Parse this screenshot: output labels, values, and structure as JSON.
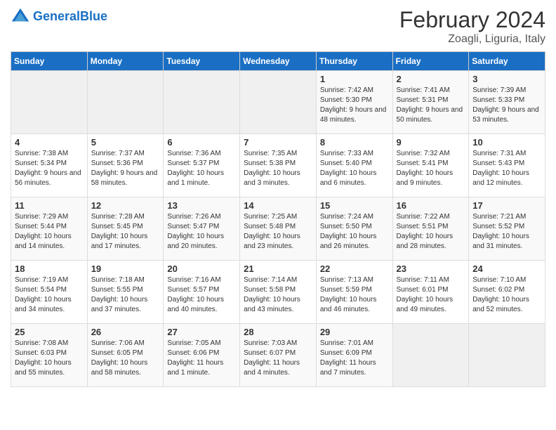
{
  "app": {
    "logo_general": "General",
    "logo_blue": "Blue",
    "title": "February 2024",
    "subtitle": "Zoagli, Liguria, Italy"
  },
  "calendar": {
    "days_of_week": [
      "Sunday",
      "Monday",
      "Tuesday",
      "Wednesday",
      "Thursday",
      "Friday",
      "Saturday"
    ],
    "weeks": [
      [
        {
          "day": "",
          "info": ""
        },
        {
          "day": "",
          "info": ""
        },
        {
          "day": "",
          "info": ""
        },
        {
          "day": "",
          "info": ""
        },
        {
          "day": "1",
          "info": "Sunrise: 7:42 AM\nSunset: 5:30 PM\nDaylight: 9 hours and 48 minutes."
        },
        {
          "day": "2",
          "info": "Sunrise: 7:41 AM\nSunset: 5:31 PM\nDaylight: 9 hours and 50 minutes."
        },
        {
          "day": "3",
          "info": "Sunrise: 7:39 AM\nSunset: 5:33 PM\nDaylight: 9 hours and 53 minutes."
        }
      ],
      [
        {
          "day": "4",
          "info": "Sunrise: 7:38 AM\nSunset: 5:34 PM\nDaylight: 9 hours and 56 minutes."
        },
        {
          "day": "5",
          "info": "Sunrise: 7:37 AM\nSunset: 5:36 PM\nDaylight: 9 hours and 58 minutes."
        },
        {
          "day": "6",
          "info": "Sunrise: 7:36 AM\nSunset: 5:37 PM\nDaylight: 10 hours and 1 minute."
        },
        {
          "day": "7",
          "info": "Sunrise: 7:35 AM\nSunset: 5:38 PM\nDaylight: 10 hours and 3 minutes."
        },
        {
          "day": "8",
          "info": "Sunrise: 7:33 AM\nSunset: 5:40 PM\nDaylight: 10 hours and 6 minutes."
        },
        {
          "day": "9",
          "info": "Sunrise: 7:32 AM\nSunset: 5:41 PM\nDaylight: 10 hours and 9 minutes."
        },
        {
          "day": "10",
          "info": "Sunrise: 7:31 AM\nSunset: 5:43 PM\nDaylight: 10 hours and 12 minutes."
        }
      ],
      [
        {
          "day": "11",
          "info": "Sunrise: 7:29 AM\nSunset: 5:44 PM\nDaylight: 10 hours and 14 minutes."
        },
        {
          "day": "12",
          "info": "Sunrise: 7:28 AM\nSunset: 5:45 PM\nDaylight: 10 hours and 17 minutes."
        },
        {
          "day": "13",
          "info": "Sunrise: 7:26 AM\nSunset: 5:47 PM\nDaylight: 10 hours and 20 minutes."
        },
        {
          "day": "14",
          "info": "Sunrise: 7:25 AM\nSunset: 5:48 PM\nDaylight: 10 hours and 23 minutes."
        },
        {
          "day": "15",
          "info": "Sunrise: 7:24 AM\nSunset: 5:50 PM\nDaylight: 10 hours and 26 minutes."
        },
        {
          "day": "16",
          "info": "Sunrise: 7:22 AM\nSunset: 5:51 PM\nDaylight: 10 hours and 28 minutes."
        },
        {
          "day": "17",
          "info": "Sunrise: 7:21 AM\nSunset: 5:52 PM\nDaylight: 10 hours and 31 minutes."
        }
      ],
      [
        {
          "day": "18",
          "info": "Sunrise: 7:19 AM\nSunset: 5:54 PM\nDaylight: 10 hours and 34 minutes."
        },
        {
          "day": "19",
          "info": "Sunrise: 7:18 AM\nSunset: 5:55 PM\nDaylight: 10 hours and 37 minutes."
        },
        {
          "day": "20",
          "info": "Sunrise: 7:16 AM\nSunset: 5:57 PM\nDaylight: 10 hours and 40 minutes."
        },
        {
          "day": "21",
          "info": "Sunrise: 7:14 AM\nSunset: 5:58 PM\nDaylight: 10 hours and 43 minutes."
        },
        {
          "day": "22",
          "info": "Sunrise: 7:13 AM\nSunset: 5:59 PM\nDaylight: 10 hours and 46 minutes."
        },
        {
          "day": "23",
          "info": "Sunrise: 7:11 AM\nSunset: 6:01 PM\nDaylight: 10 hours and 49 minutes."
        },
        {
          "day": "24",
          "info": "Sunrise: 7:10 AM\nSunset: 6:02 PM\nDaylight: 10 hours and 52 minutes."
        }
      ],
      [
        {
          "day": "25",
          "info": "Sunrise: 7:08 AM\nSunset: 6:03 PM\nDaylight: 10 hours and 55 minutes."
        },
        {
          "day": "26",
          "info": "Sunrise: 7:06 AM\nSunset: 6:05 PM\nDaylight: 10 hours and 58 minutes."
        },
        {
          "day": "27",
          "info": "Sunrise: 7:05 AM\nSunset: 6:06 PM\nDaylight: 11 hours and 1 minute."
        },
        {
          "day": "28",
          "info": "Sunrise: 7:03 AM\nSunset: 6:07 PM\nDaylight: 11 hours and 4 minutes."
        },
        {
          "day": "29",
          "info": "Sunrise: 7:01 AM\nSunset: 6:09 PM\nDaylight: 11 hours and 7 minutes."
        },
        {
          "day": "",
          "info": ""
        },
        {
          "day": "",
          "info": ""
        }
      ]
    ]
  }
}
